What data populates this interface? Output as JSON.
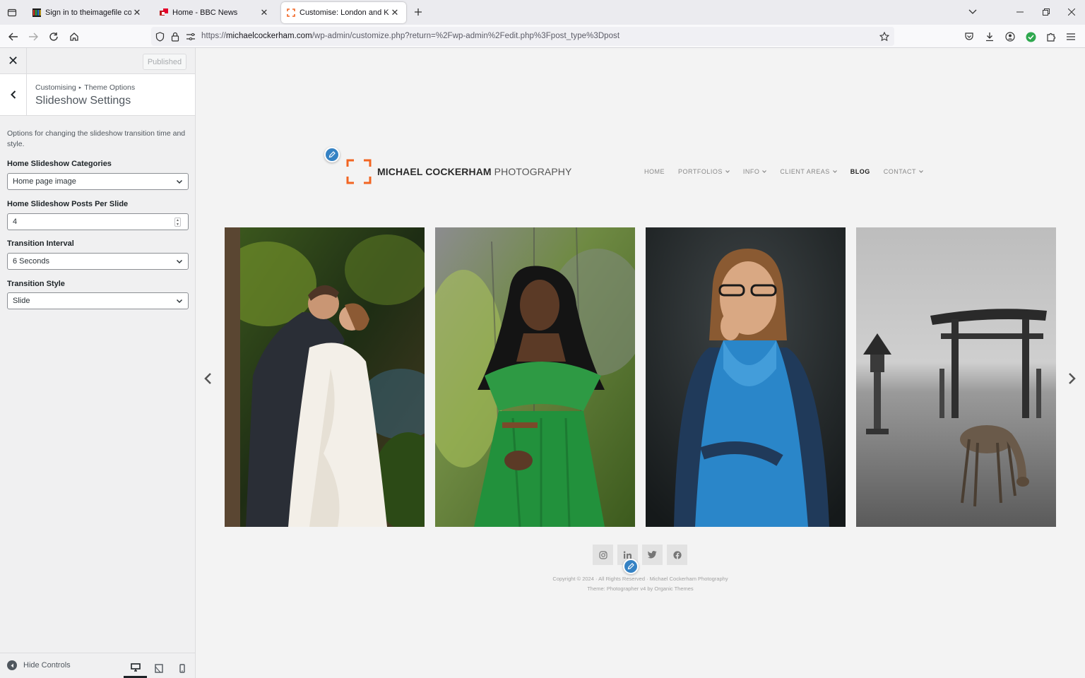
{
  "browser": {
    "tabs": [
      {
        "title": "Sign in to theimagefile control panel",
        "active": false
      },
      {
        "title": "Home - BBC News",
        "active": false
      },
      {
        "title": "Customise: London and Kent commercial and portrait photographer",
        "active": true
      }
    ],
    "url_prefix": "https://",
    "url_domain": "michaelcockerham.com",
    "url_path": "/wp-admin/customize.php?return=%2Fwp-admin%2Fedit.php%3Fpost_type%3Dpost"
  },
  "customizer": {
    "close_label": "✕",
    "published_label": "Published",
    "breadcrumb_root": "Customising",
    "breadcrumb_parent": "Theme Options",
    "section_title": "Slideshow Settings",
    "description": "Options for changing the slideshow transition time and style.",
    "fields": [
      {
        "label": "Home Slideshow Categories",
        "value": "Home page image"
      },
      {
        "label": "Home Slideshow Posts Per Slide",
        "value": "4"
      },
      {
        "label": "Transition Interval",
        "value": "6 Seconds"
      },
      {
        "label": "Transition Style",
        "value": "Slide"
      }
    ],
    "hide_controls_label": "Hide Controls"
  },
  "site": {
    "logo_bold": "MICHAEL COCKERHAM",
    "logo_light": "PHOTOGRAPHY",
    "menu": [
      {
        "label": "HOME",
        "dropdown": false,
        "active": false
      },
      {
        "label": "PORTFOLIOS",
        "dropdown": true,
        "active": false
      },
      {
        "label": "INFO",
        "dropdown": true,
        "active": false
      },
      {
        "label": "CLIENT AREAS",
        "dropdown": true,
        "active": false
      },
      {
        "label": "BLOG",
        "dropdown": false,
        "active": true
      },
      {
        "label": "CONTACT",
        "dropdown": true,
        "active": false
      }
    ],
    "photos": [
      "wedding-couple-kiss",
      "woman-in-green-dress",
      "woman-in-blue-apron",
      "torii-gate-and-deer"
    ],
    "social": [
      "instagram-icon",
      "linkedin-icon",
      "twitter-icon",
      "facebook-icon"
    ],
    "copyright_line1": "Copyright © 2024 · All Rights Reserved · Michael Cockerham Photography",
    "copyright_line2": "Theme: Photographer v4 by Organic Themes"
  },
  "colors": {
    "accent_orange": "#f26522",
    "edit_blue": "#3582c4",
    "wp_dark": "#1d2327"
  }
}
